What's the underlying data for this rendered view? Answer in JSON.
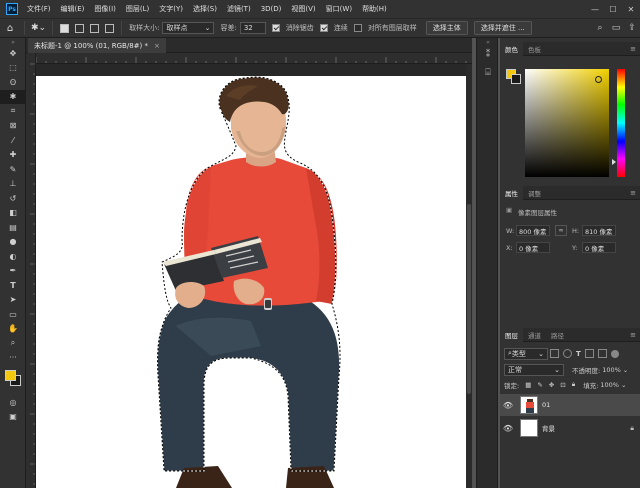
{
  "app": {
    "logo_text": "Ps"
  },
  "menubar": {
    "items": [
      "文件(F)",
      "编辑(E)",
      "图像(I)",
      "图层(L)",
      "文字(Y)",
      "选择(S)",
      "滤镜(T)",
      "3D(D)",
      "视图(V)",
      "窗口(W)",
      "帮助(H)"
    ]
  },
  "window_controls": {
    "minimize": "—",
    "maximize": "☐",
    "close": "✕"
  },
  "options": {
    "sample_size_label": "取样大小:",
    "sample_size_value": "取样点",
    "tolerance_label": "容差:",
    "tolerance_value": "32",
    "antialias_label": "消除锯齿",
    "contiguous_label": "连续",
    "sample_all_label": "对所有图层取样",
    "select_subject_label": "选择主体",
    "select_mask_label": "选择并遮住 ..."
  },
  "document": {
    "tab_title": "未标题-1 @ 100% (01, RGB/8#) *",
    "close_glyph": "×"
  },
  "panels": {
    "color_tabs": [
      "颜色",
      "色板"
    ],
    "props_tabs": [
      "属性",
      "调整"
    ],
    "props_title": "像素图层属性",
    "w_label": "W:",
    "w_value": "800 像素",
    "h_label": "H:",
    "h_value": "810 像素",
    "x_label": "X:",
    "x_value": "0 像素",
    "y_label": "Y:",
    "y_value": "0 像素",
    "layers_tabs": [
      "图层",
      "通道",
      "路径"
    ],
    "filter_value": "类型",
    "blend_mode": "正常",
    "opacity_label": "不透明度:",
    "opacity_value": "100%",
    "lock_label": "锁定:",
    "fill_label": "填充:",
    "fill_value": "100%",
    "layers": [
      {
        "name": "01",
        "selected": true
      },
      {
        "name": "背景",
        "selected": false,
        "locked": true
      }
    ]
  },
  "colors": {
    "foreground": "#f2c811",
    "background": "#1a1a1a",
    "accent": "#31a8ff"
  }
}
